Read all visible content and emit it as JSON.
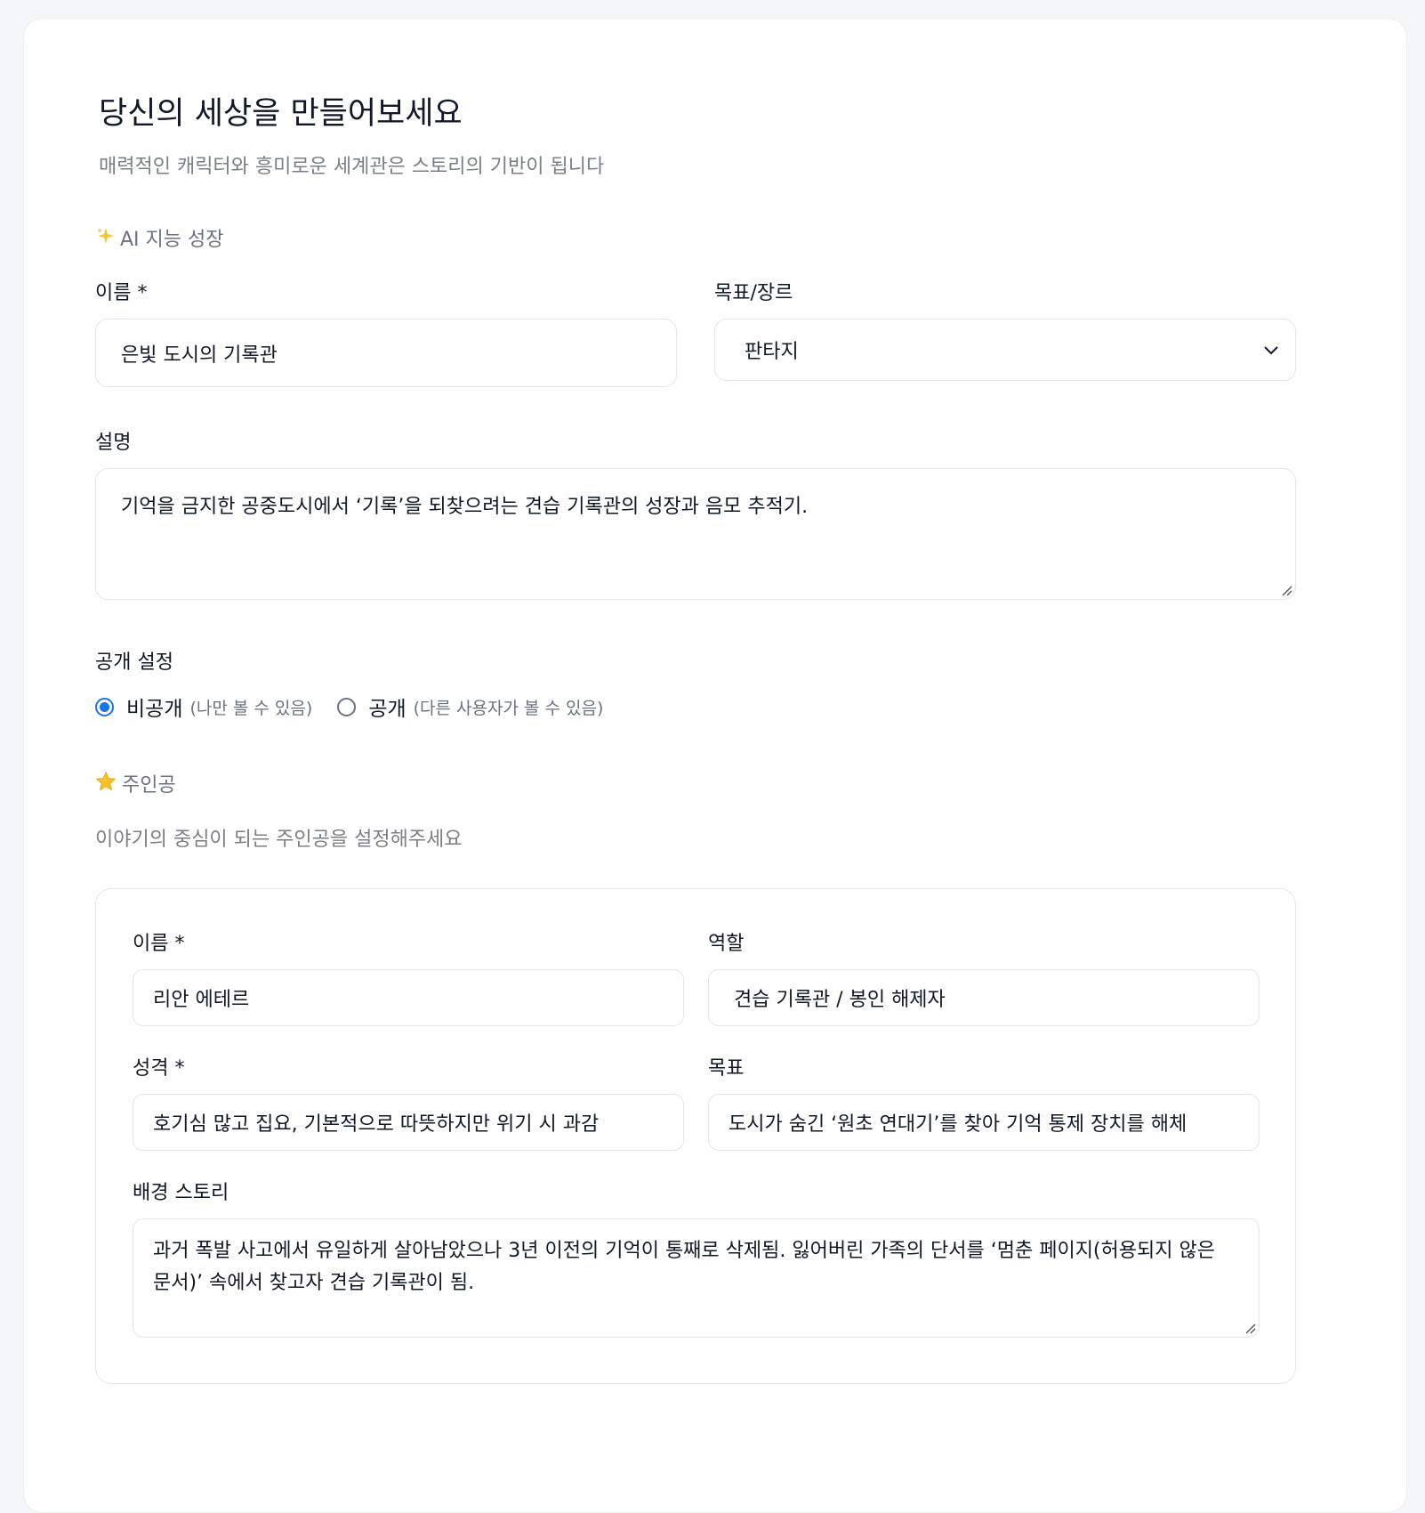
{
  "header": {
    "title": "당신의 세상을 만들어보세요",
    "subtitle": "매력적인 캐릭터와 흥미로운 세계관은 스토리의 기반이 됩니다"
  },
  "ai_section": {
    "icon": "sparkles-icon",
    "label": "AI 지능 성장"
  },
  "world": {
    "name_label": "이름 *",
    "name_value": "은빛 도시의 기록관",
    "genre_label": "목표/장르",
    "genre_value": "판타지",
    "description_label": "설명",
    "description_value": "기억을 금지한 공중도시에서 ‘기록’을 되찾으려는 견습 기록관의 성장과 음모 추적기."
  },
  "visibility": {
    "label": "공개 설정",
    "options": [
      {
        "label": "비공개",
        "hint": "(나만 볼 수 있음)",
        "selected": true
      },
      {
        "label": "공개",
        "hint": "(다른 사용자가 볼 수 있음)",
        "selected": false
      }
    ],
    "accent": "#1a73e8"
  },
  "protagonist_section": {
    "icon": "star-icon",
    "label": "주인공",
    "description": "이야기의 중심이 되는 주인공을 설정해주세요"
  },
  "protagonist": {
    "name_label": "이름 *",
    "name_value": "리안 에테르",
    "role_label": "역할",
    "role_value": "견습 기록관 / 봉인 해제자",
    "personality_label": "성격 *",
    "personality_value": "호기심 많고 집요, 기본적으로 따뜻하지만 위기 시 과감",
    "goal_label": "목표",
    "goal_value": "도시가 숨긴 ‘원초 연대기’를 찾아 기억 통제 장치를 해체",
    "backstory_label": "배경 스토리",
    "backstory_value": "과거 폭발 사고에서 유일하게 살아남았으나 3년 이전의 기억이 통째로 삭제됨. 잃어버린 가족의 단서를 ‘멈춘 페이지(허용되지 않은 문서)’ 속에서 찾고자 견습 기록관이 됨."
  }
}
